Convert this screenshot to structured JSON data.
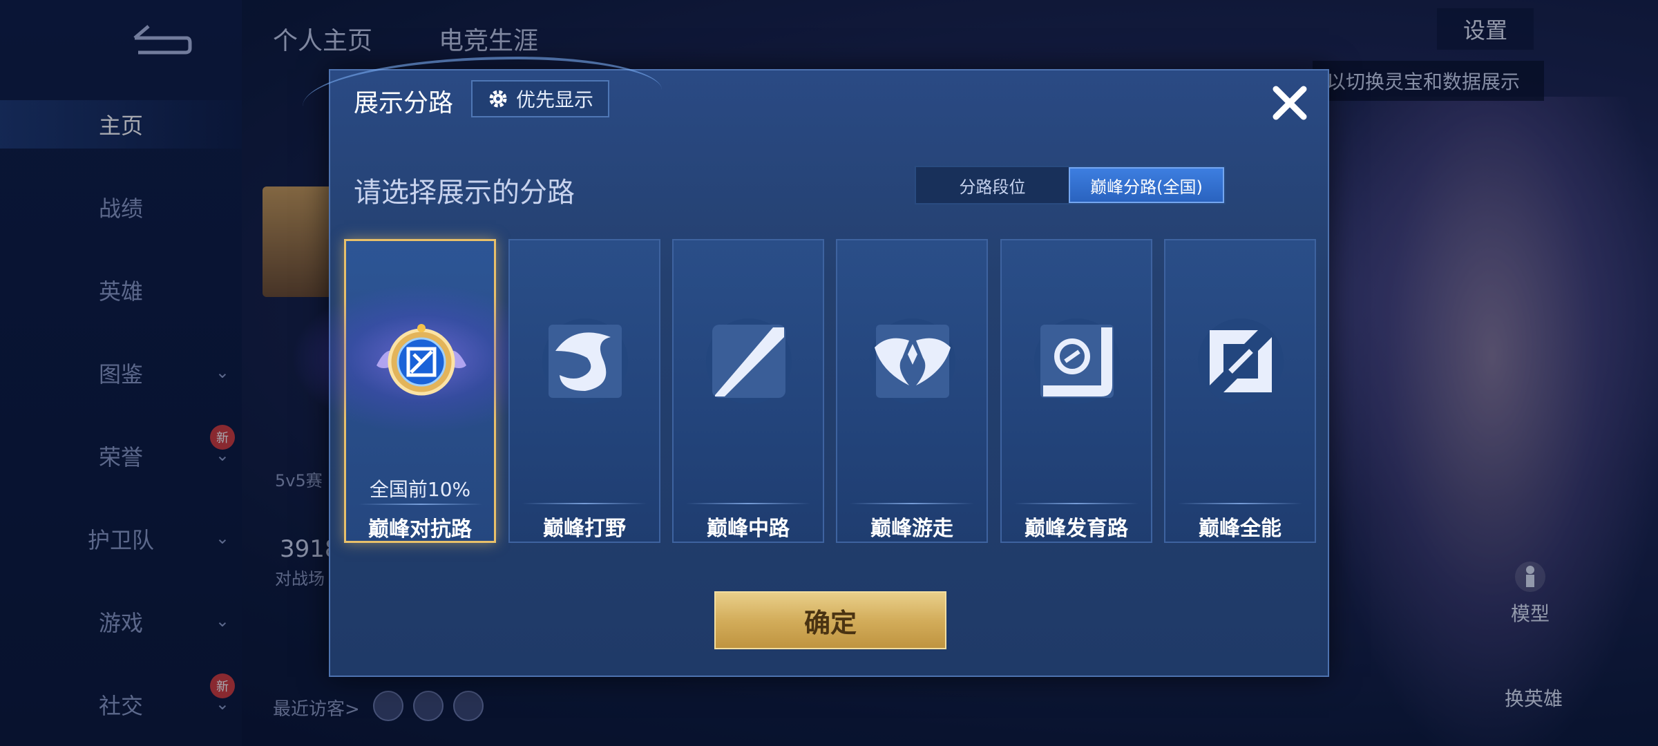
{
  "background": {
    "top_tabs": [
      "个人主页",
      "电竞生涯"
    ],
    "sidebar": [
      {
        "label": "主页",
        "active": true,
        "chevron": false,
        "badge": ""
      },
      {
        "label": "战绩",
        "active": false,
        "chevron": false,
        "badge": ""
      },
      {
        "label": "英雄",
        "active": false,
        "chevron": false,
        "badge": ""
      },
      {
        "label": "图鉴",
        "active": false,
        "chevron": true,
        "badge": ""
      },
      {
        "label": "荣誉",
        "active": false,
        "chevron": true,
        "badge": "新"
      },
      {
        "label": "护卫队",
        "active": false,
        "chevron": true,
        "badge": ""
      },
      {
        "label": "游戏",
        "active": false,
        "chevron": true,
        "badge": ""
      },
      {
        "label": "社交",
        "active": false,
        "chevron": true,
        "badge": "新"
      }
    ],
    "settings_label": "设置",
    "tip_text": "以切换灵宝和数据展示",
    "model_label": "模型",
    "swap_hero_label": "换英雄",
    "recent_visitors_label": "最近访客>",
    "stat_value": "3918",
    "stat_label": "对战场",
    "mode_label": "5v5赛"
  },
  "modal": {
    "title": "展示分路",
    "priority_button_label": "优先显示",
    "subtitle": "请选择展示的分路",
    "toggle_options": [
      {
        "label": "分路段位",
        "active": false
      },
      {
        "label": "巅峰分路(全国)",
        "active": true
      }
    ],
    "cards": [
      {
        "label": "巅峰对抗路",
        "rank": "全国前10%",
        "selected": true,
        "icon": "fighter-lane-emblem"
      },
      {
        "label": "巅峰打野",
        "rank": "",
        "selected": false,
        "icon": "dragon-jungle-icon"
      },
      {
        "label": "巅峰中路",
        "rank": "",
        "selected": false,
        "icon": "mid-lane-icon"
      },
      {
        "label": "巅峰游走",
        "rank": "",
        "selected": false,
        "icon": "wings-roam-icon"
      },
      {
        "label": "巅峰发育路",
        "rank": "",
        "selected": false,
        "icon": "farm-lane-icon"
      },
      {
        "label": "巅峰全能",
        "rank": "",
        "selected": false,
        "icon": "all-round-icon"
      }
    ],
    "confirm_label": "确定"
  },
  "colors": {
    "selected_border": "#e8c06a",
    "toggle_active": "#3d7ee0",
    "confirm_gold": "#d3ad5b"
  }
}
